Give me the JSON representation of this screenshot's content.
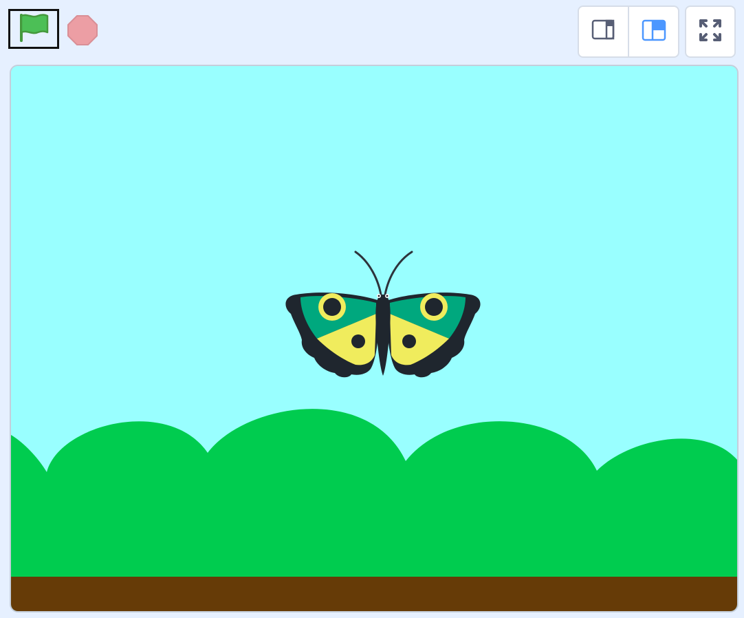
{
  "toolbar": {
    "green_flag": {
      "icon": "green-flag-icon",
      "color": "#4cbf56"
    },
    "stop": {
      "icon": "stop-sign-icon",
      "color": "#ec9ea4",
      "state": "inactive"
    },
    "layout_modes": [
      {
        "icon": "small-stage-icon",
        "selected": false
      },
      {
        "icon": "normal-stage-icon",
        "selected": true
      }
    ],
    "fullscreen": {
      "icon": "fullscreen-icon"
    }
  },
  "stage": {
    "backdrop": {
      "sky_color": "#99ffff",
      "hills_color": "#00cc4f",
      "ground_color": "#663b07"
    },
    "sprite": {
      "name_icon": "butterfly-icon",
      "wing_outer_color": "#00a87e",
      "wing_inner_color": "#f0ec5d",
      "body_color": "#1f262e"
    }
  },
  "colors": {
    "page_bg": "#e6f0ff",
    "accent_blue": "#4c97ff",
    "icon_gray": "#575e75"
  }
}
